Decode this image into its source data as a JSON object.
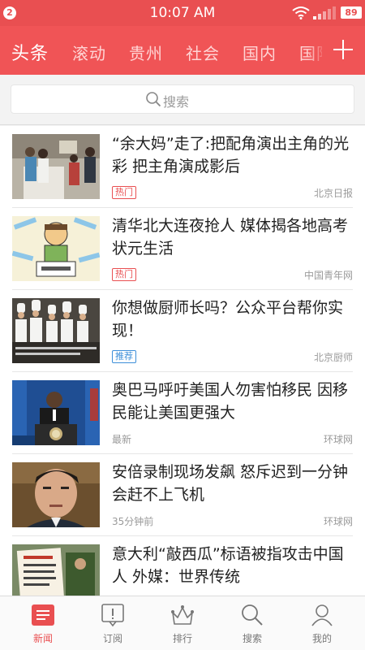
{
  "status_bar": {
    "notification_count": "2",
    "time": "10:07 AM",
    "battery": "89"
  },
  "categories": {
    "items": [
      "头条",
      "滚动",
      "贵州",
      "社会",
      "国内",
      "国际"
    ],
    "active": "头条",
    "add_icon": "plus-icon"
  },
  "search": {
    "placeholder": "搜索",
    "icon": "search-icon"
  },
  "news": [
    {
      "title": "“余大妈”走了:把配角演出主角的光彩 把主角演成影后",
      "tag": "热门",
      "tag_type": "hot",
      "time": "",
      "source": "北京日报"
    },
    {
      "title": "清华北大连夜抢人 媒体揭各地高考状元生活",
      "tag": "热门",
      "tag_type": "hot",
      "time": "",
      "source": "中国青年网"
    },
    {
      "title": "你想做厨师长吗？公众平台帮你实现！",
      "tag": "推荐",
      "tag_type": "rec",
      "time": "",
      "source": "北京厨师"
    },
    {
      "title": "奥巴马呼吁美国人勿害怕移民 因移民能让美国更强大",
      "tag": "",
      "tag_type": "",
      "time": "最新",
      "source": "环球网"
    },
    {
      "title": "安倍录制现场发飙 怒斥迟到一分钟会赶不上飞机",
      "tag": "",
      "tag_type": "",
      "time": "35分钟前",
      "source": "环球网"
    },
    {
      "title": "意大利“敲西瓜”标语被指攻击中国人 外媒：世界传统",
      "tag": "",
      "tag_type": "",
      "time": "",
      "source": ""
    }
  ],
  "bottom_nav": [
    {
      "label": "新闻",
      "icon": "news-icon",
      "active": true
    },
    {
      "label": "订阅",
      "icon": "subscribe-icon",
      "active": false
    },
    {
      "label": "排行",
      "icon": "ranking-crown-icon",
      "active": false
    },
    {
      "label": "搜索",
      "icon": "search-icon",
      "active": false
    },
    {
      "label": "我的",
      "icon": "profile-icon",
      "active": false
    }
  ],
  "colors": {
    "brand_red": "#f05456",
    "status_red": "#e94f51",
    "hot_tag": "#e94f51",
    "recommend_tag": "#3d8fd9"
  }
}
